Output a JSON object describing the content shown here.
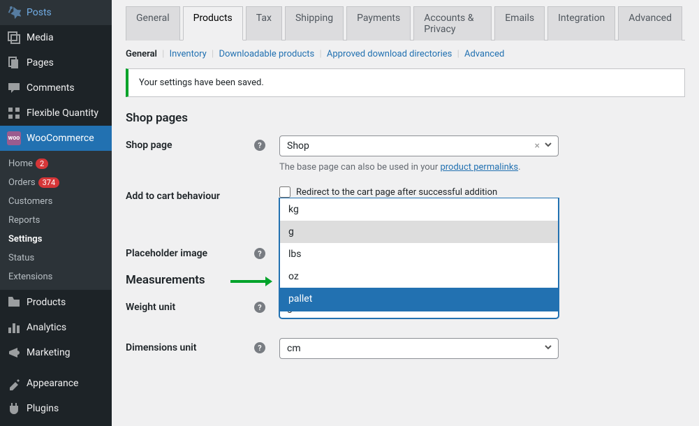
{
  "sidebar": {
    "items": [
      {
        "label": "Posts",
        "icon": "pin"
      },
      {
        "label": "Media",
        "icon": "media"
      },
      {
        "label": "Pages",
        "icon": "pages"
      },
      {
        "label": "Comments",
        "icon": "comments"
      },
      {
        "label": "Flexible Quantity",
        "icon": "grid"
      }
    ],
    "woo": {
      "label": "WooCommerce"
    },
    "sub": [
      {
        "label": "Home",
        "badge": "2"
      },
      {
        "label": "Orders",
        "badge": "374"
      },
      {
        "label": "Customers"
      },
      {
        "label": "Reports"
      },
      {
        "label": "Settings",
        "active": true
      },
      {
        "label": "Status"
      },
      {
        "label": "Extensions"
      }
    ],
    "items2": [
      {
        "label": "Products",
        "icon": "products"
      },
      {
        "label": "Analytics",
        "icon": "analytics"
      },
      {
        "label": "Marketing",
        "icon": "marketing"
      },
      {
        "label": "Appearance",
        "icon": "appearance"
      },
      {
        "label": "Plugins",
        "icon": "plugins"
      }
    ]
  },
  "tabs": [
    "General",
    "Products",
    "Tax",
    "Shipping",
    "Payments",
    "Accounts & Privacy",
    "Emails",
    "Integration",
    "Advanced"
  ],
  "active_tab": 1,
  "subtabs": [
    "General",
    "Inventory",
    "Downloadable products",
    "Approved download directories",
    "Advanced"
  ],
  "notice": "Your settings have been saved.",
  "sections": {
    "shop_pages": "Shop pages",
    "measurements": "Measurements"
  },
  "fields": {
    "shop_page": {
      "label": "Shop page",
      "value": "Shop",
      "desc_prefix": "The base page can also be used in your ",
      "desc_link": "product permalinks",
      "desc_suffix": "."
    },
    "cart": {
      "label": "Add to cart behaviour",
      "checkbox": "Redirect to the cart page after successful addition"
    },
    "placeholder": {
      "label": "Placeholder image"
    },
    "weight": {
      "label": "Weight unit",
      "value": "g",
      "options": [
        "kg",
        "g",
        "lbs",
        "oz",
        "pallet"
      ]
    },
    "dimensions": {
      "label": "Dimensions unit",
      "value": "cm"
    }
  }
}
